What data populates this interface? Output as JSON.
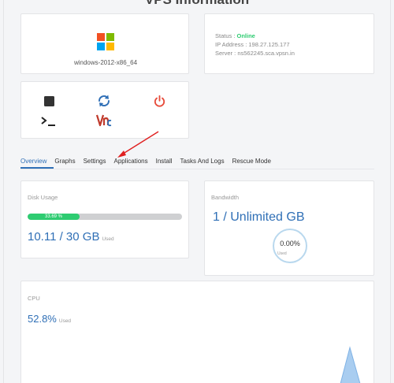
{
  "page": {
    "title": "VPS Information"
  },
  "os": {
    "name": "windows-2012-x86_64"
  },
  "status": {
    "status_label": "Status : ",
    "status_value": "Online",
    "ip_label": "IP Address : ",
    "ip_value": "198.27.125.177",
    "server_label": "Server : ",
    "server_value": "ns562245.sca.vpsn.in"
  },
  "controls": {
    "stop_icon": "stop-icon",
    "restart_icon": "restart-icon",
    "power_icon": "power-icon",
    "console_icon": "console-icon",
    "vnc_icon": "vnc-icon"
  },
  "tabs": [
    {
      "label": "Overview",
      "active": true
    },
    {
      "label": "Graphs"
    },
    {
      "label": "Settings"
    },
    {
      "label": "Applications"
    },
    {
      "label": "Install"
    },
    {
      "label": "Tasks And Logs"
    },
    {
      "label": "Rescue Mode"
    }
  ],
  "disk": {
    "label": "Disk Usage",
    "percent_text": "33.69 %",
    "percent": 33.69,
    "value": "10.11 / 30 GB",
    "used_label": "Used"
  },
  "bandwidth": {
    "label": "Bandwidth",
    "value": "1 / Unlimited GB",
    "percent_text": "0.00%",
    "used_label": "Used"
  },
  "cpu": {
    "label": "CPU",
    "value": "52.8%",
    "used_label": "Used"
  },
  "colors": {
    "accent": "#2f6fb6",
    "online": "#2ecc71",
    "power": "#e74c3c",
    "arrow": "#e02020"
  }
}
